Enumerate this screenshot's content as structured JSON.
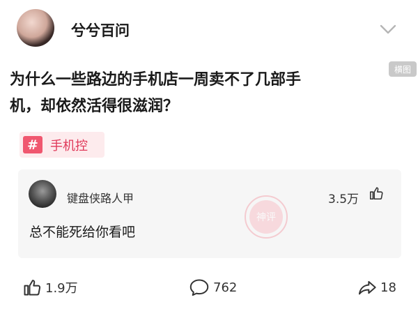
{
  "post": {
    "author": "兮兮百问",
    "report_label": "横图",
    "title_line1": "为什么一些路边的手机店一周卖不了几部手",
    "title_line2": "机，却依然活得很滋润？",
    "topic_hash": "#",
    "topic": "手机控"
  },
  "hot_comment": {
    "username": "键盘侠路人甲",
    "likes": "3.5万",
    "text": "总不能死给你看吧",
    "stamp_text": "神评"
  },
  "actions": {
    "likes": "1.9万",
    "comments": "762",
    "shares": "18"
  },
  "colors": {
    "accent": "#f0576f",
    "topic_bg": "#fdebed",
    "comment_bg": "#f6f6f6"
  }
}
